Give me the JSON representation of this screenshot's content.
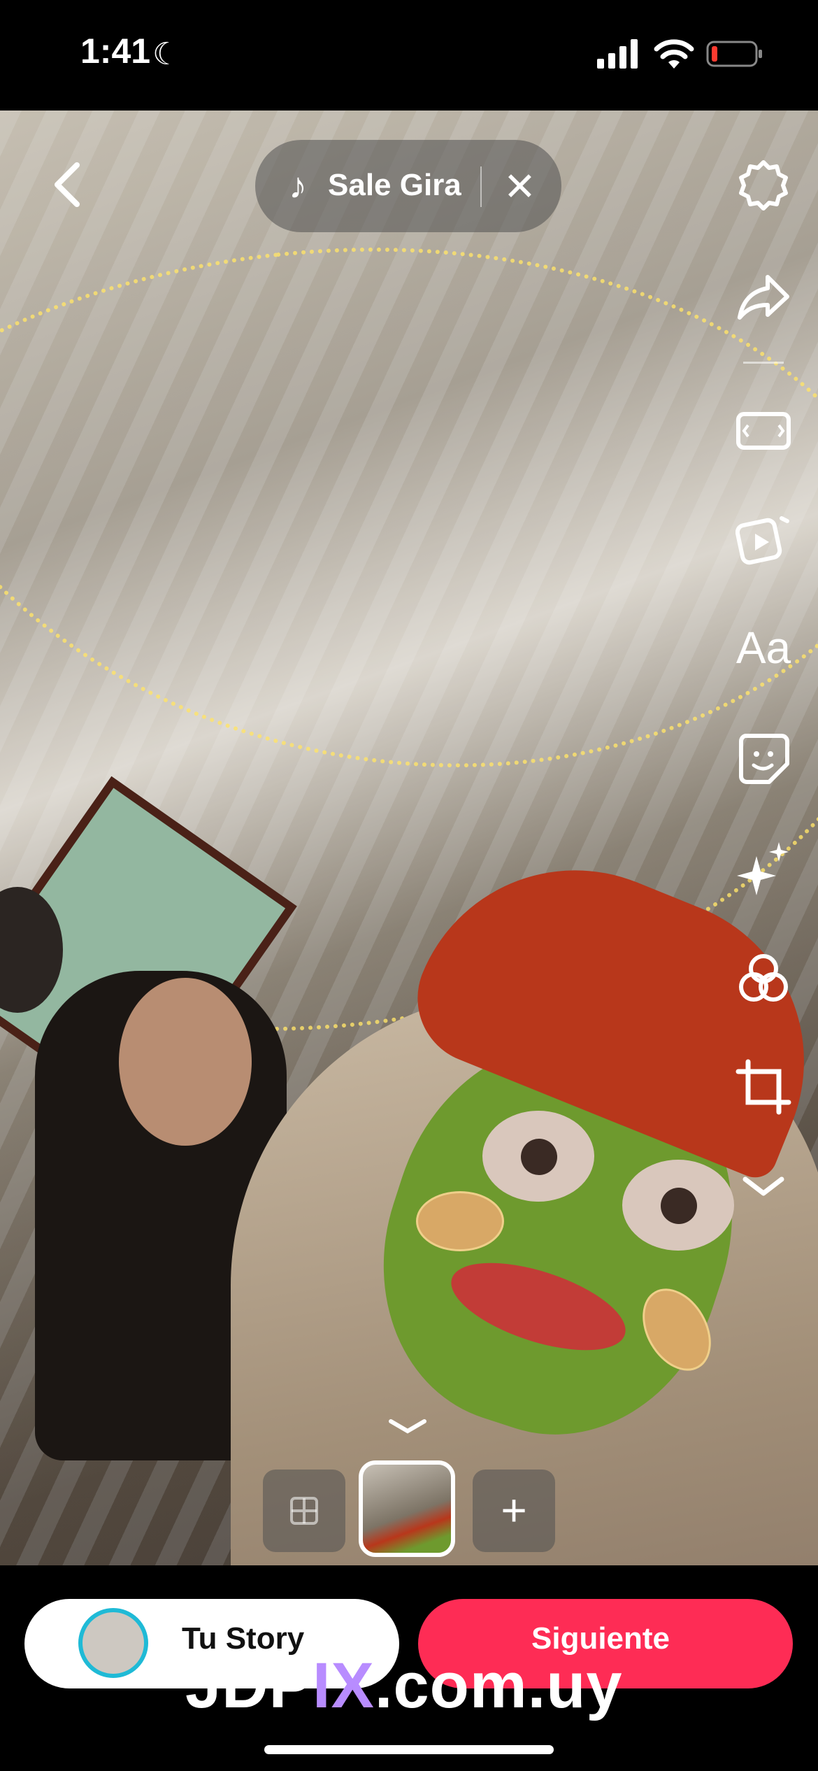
{
  "status_bar": {
    "time": "1:41",
    "moon_icon": "moon-icon",
    "signal_icon": "cellular-signal-icon",
    "wifi_icon": "wifi-icon",
    "battery_icon": "battery-low-icon",
    "battery_color": "#ff3b30"
  },
  "editor": {
    "music": {
      "title": "Sale Gira",
      "note": "♪",
      "close": "✕"
    },
    "tools": [
      {
        "name": "settings-icon"
      },
      {
        "name": "share-icon"
      },
      {
        "name": "resize-icon"
      },
      {
        "name": "video-clip-icon"
      },
      {
        "name": "text-icon",
        "label": "Aa"
      },
      {
        "name": "sticker-icon"
      },
      {
        "name": "effects-icon"
      },
      {
        "name": "filters-icon"
      },
      {
        "name": "crop-icon"
      },
      {
        "name": "chevron-down-icon"
      }
    ]
  },
  "thumbnails": {
    "add": "+"
  },
  "bottom": {
    "story_label": "Tu Story",
    "next_label": "Siguiente",
    "accent_color": "#fe2c55",
    "ring_color": "#1fbad6"
  },
  "watermark": {
    "before": "JDP",
    "accent": "IX",
    "after": ".com.uy"
  }
}
